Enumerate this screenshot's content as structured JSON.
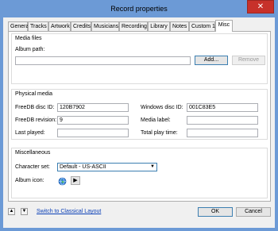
{
  "window": {
    "title": "Record properties",
    "close_glyph": "✕"
  },
  "tabs": [
    {
      "label": "General"
    },
    {
      "label": "Tracks"
    },
    {
      "label": "Artwork"
    },
    {
      "label": "Credits"
    },
    {
      "label": "Musicians"
    },
    {
      "label": "Recording"
    },
    {
      "label": "Library"
    },
    {
      "label": "Notes"
    },
    {
      "label": "Custom 1"
    },
    {
      "label": "Misc"
    }
  ],
  "media_files": {
    "title": "Media files",
    "album_path_label": "Album path:",
    "album_path_value": "",
    "add_label": "Add...",
    "remove_label": "Remove"
  },
  "physical_media": {
    "title": "Physical media",
    "freedb_disc_id_label": "FreeDB disc ID:",
    "freedb_disc_id_value": "120B7902",
    "freedb_revision_label": "FreeDB revision:",
    "freedb_revision_value": "9",
    "last_played_label": "Last played:",
    "last_played_value": "",
    "windows_disc_id_label": "Windows disc ID:",
    "windows_disc_id_value": "001C83E5",
    "media_label_label": "Media label:",
    "media_label_value": "",
    "total_play_time_label": "Total play time:",
    "total_play_time_value": ""
  },
  "miscellaneous": {
    "title": "Miscellaneous",
    "character_set_label": "Character set:",
    "character_set_value": "Default - US-ASCII",
    "album_icon_label": "Album icon:",
    "album_icon_name": "globe-icon"
  },
  "footer": {
    "up_glyph": "▲",
    "down_glyph": "▼",
    "switch_link": "Switch to Classical Layout",
    "ok_label": "OK",
    "cancel_label": "Cancel"
  },
  "colors": {
    "title_bar": "#6c9ad6",
    "close_button": "#c7312a",
    "link": "#0a3fb6",
    "focus_border": "#3c7fb1"
  }
}
